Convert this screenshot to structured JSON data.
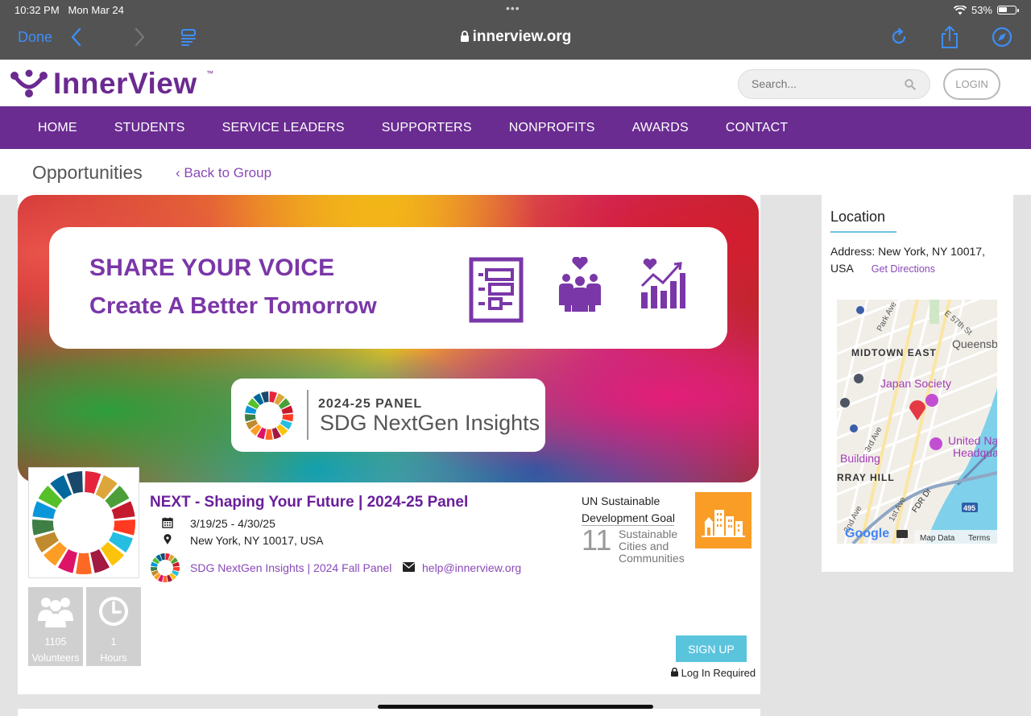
{
  "status_bar": {
    "time": "10:32 PM",
    "date": "Mon Mar 24",
    "dots": "•••",
    "battery": "53%"
  },
  "browser": {
    "done_label": "Done",
    "url": "innerview.org"
  },
  "site": {
    "logo_text": "InnerView",
    "logo_tm": "™",
    "search_placeholder": "Search...",
    "login_label": "LOGIN",
    "nav": [
      "HOME",
      "STUDENTS",
      "SERVICE LEADERS",
      "SUPPORTERS",
      "NONPROFITS",
      "AWARDS",
      "CONTACT"
    ]
  },
  "page": {
    "title": "Opportunities",
    "back_link": "‹ Back to Group"
  },
  "banner": {
    "headline": "SHARE YOUR VOICE",
    "subheadline": "Create A Better Tomorrow",
    "panel_label": "2024-25  PANEL",
    "panel_name": "SDG NextGen Insights"
  },
  "opportunity": {
    "title": "NEXT - Shaping Your Future | 2024-25 Panel",
    "dates": "3/19/25 - 4/30/25",
    "location": "New York, NY 10017, USA",
    "group_link": "SDG NextGen Insights | 2024 Fall Panel",
    "email": "help@innerview.org",
    "volunteers_count": "1105",
    "volunteers_label": "Volunteers",
    "hours_count": "1",
    "hours_label": "Hours",
    "sdg_label": "UN Sustainable Development Goal",
    "sdg_number": "11",
    "sdg_name": "Sustainable Cities and Communities",
    "signup_label": "SIGN UP",
    "login_required": "Log In Required"
  },
  "sidebar": {
    "title": "Location",
    "address": "Address: New York, NY 10017, USA",
    "directions": "Get Directions",
    "map_labels": {
      "park_ave": "Park Ave",
      "e57": "E 57th St",
      "midtown": "MIDTOWN EAST",
      "queens": "Queensb",
      "japan": "Japan Society",
      "third_ave": "3rd Ave",
      "un": "United Na",
      "un2": "Headqua",
      "building": "Building",
      "murray": "RRAY HILL",
      "fdr": "FDR Dr",
      "second_ave": "2nd Ave",
      "first_ave": "1st Ave",
      "route": "495",
      "google": "Google",
      "map_data": "Map Data",
      "terms": "Terms"
    }
  },
  "colors": {
    "brand_purple": "#6a2c91",
    "link_purple": "#8a49b8",
    "signup_blue": "#5bc4dd",
    "sdg11_orange": "#f99d26"
  }
}
